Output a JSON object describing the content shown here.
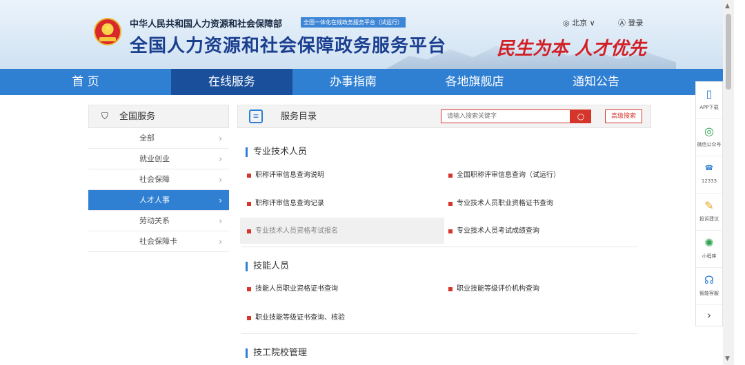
{
  "header": {
    "ministry": "中华人民共和国人力资源和社会保障部",
    "tag": "全国一体化在线政务服务平台（试运行）",
    "site_name": "全国人力资源和社会保障政务服务平台",
    "slogan": "民生为本 人才优先",
    "location": "◎ 北京 ∨",
    "login": "Ⓐ 登录"
  },
  "nav": {
    "items": [
      {
        "label": "首 页"
      },
      {
        "label": "在线服务"
      },
      {
        "label": "办事指南"
      },
      {
        "label": "各地旗舰店"
      },
      {
        "label": "通知公告"
      }
    ]
  },
  "leftmenu": {
    "title": "全国服务",
    "items": [
      {
        "label": "全部"
      },
      {
        "label": "就业创业"
      },
      {
        "label": "社会保障"
      },
      {
        "label": "人才人事"
      },
      {
        "label": "劳动关系"
      },
      {
        "label": "社会保障卡"
      }
    ]
  },
  "main": {
    "title": "服务目录",
    "search_placeholder": "请输入搜索关键字",
    "advanced_search": "高级搜索",
    "sections": [
      {
        "title": "专业技术人员",
        "links": [
          "职称评审信息查询说明",
          "全国职称评审信息查询（试运行）",
          "职称评审信息查询记录",
          "专业技术人员职业资格证书查询",
          "专业技术人员资格考试报名",
          "专业技术人员考试成绩查询"
        ]
      },
      {
        "title": "技能人员",
        "links": [
          "技能人员职业资格证书查询",
          "职业技能等级评价机构查询",
          "职业技能等级证书查询、核验"
        ]
      },
      {
        "title": "技工院校管理",
        "links": []
      }
    ]
  },
  "right_sidebar": {
    "items": [
      {
        "label": "APP下载"
      },
      {
        "label": "微信公众号"
      },
      {
        "label": "12333"
      },
      {
        "label": "投诉建议"
      },
      {
        "label": "小程序"
      },
      {
        "label": "智能客服"
      }
    ],
    "collapse": "›"
  },
  "colors": {
    "nav_blue": "#2f7fd3",
    "nav_active": "#1a4f9b",
    "accent_red": "#d5352b"
  }
}
